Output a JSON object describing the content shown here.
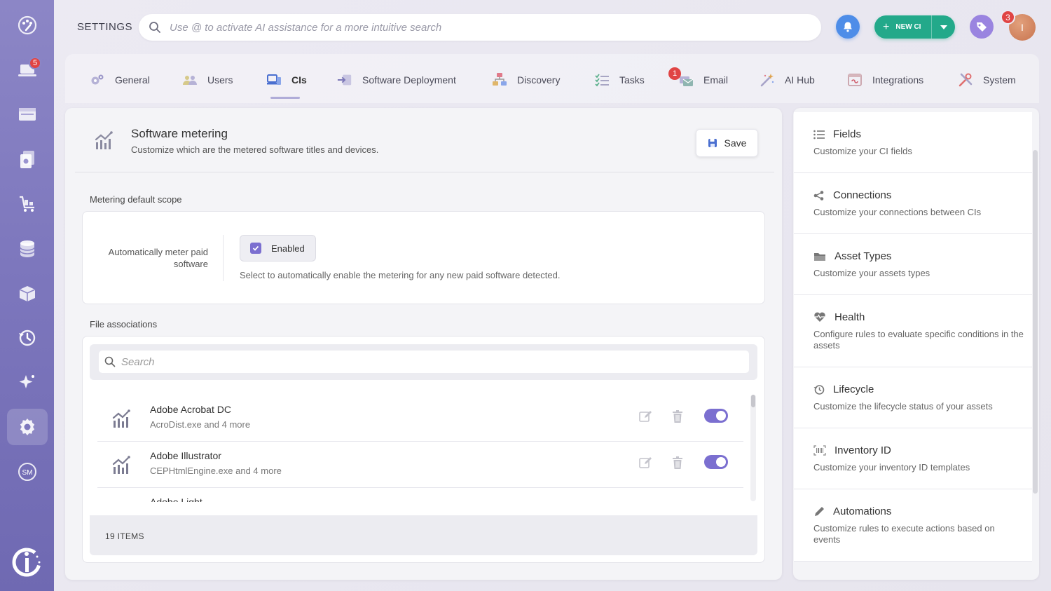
{
  "rail": {
    "items": [
      {
        "icon": "palette-icon"
      },
      {
        "icon": "laptop-icon",
        "badge": "5"
      },
      {
        "icon": "window-icon"
      },
      {
        "icon": "documents-icon"
      },
      {
        "icon": "cart-icon"
      },
      {
        "icon": "database-icon"
      },
      {
        "icon": "box-icon"
      },
      {
        "icon": "history-icon"
      },
      {
        "icon": "sparkle-icon"
      },
      {
        "icon": "gear-icon",
        "active": true
      },
      {
        "icon": "sm-icon",
        "label": "SM"
      }
    ]
  },
  "header": {
    "title": "SETTINGS",
    "search_placeholder": "Use @ to activate AI assistance for a more intuitive search",
    "new_ci_label": "NEW CI",
    "avatar_initial": "I",
    "notifications_badge": "3"
  },
  "tabs": [
    {
      "label": "General",
      "icon": "gears-icon"
    },
    {
      "label": "Users",
      "icon": "users-icon"
    },
    {
      "label": "CIs",
      "icon": "cis-icon",
      "active": true
    },
    {
      "label": "Software Deployment",
      "icon": "deploy-icon"
    },
    {
      "label": "Discovery",
      "icon": "discovery-icon"
    },
    {
      "label": "Tasks",
      "icon": "tasks-icon"
    },
    {
      "label": "Email",
      "icon": "email-icon",
      "badge": "1"
    },
    {
      "label": "AI Hub",
      "icon": "wand-icon"
    },
    {
      "label": "Integrations",
      "icon": "integrations-icon"
    },
    {
      "label": "System",
      "icon": "tools-icon"
    }
  ],
  "main": {
    "title": "Software metering",
    "subtitle": "Customize which are the metered software titles and devices.",
    "save_label": "Save",
    "scope_section_label": "Metering default scope",
    "scope_field_label": "Automatically meter paid software",
    "enabled_label": "Enabled",
    "enabled_checked": true,
    "scope_help": "Select to automatically enable the metering for any new paid software detected.",
    "files_section_label": "File associations",
    "files_search_placeholder": "Search",
    "rows": [
      {
        "title": "Adobe Acrobat DC",
        "subtitle": "AcroDist.exe and 4 more",
        "enabled": true
      },
      {
        "title": "Adobe Illustrator",
        "subtitle": "CEPHtmlEngine.exe and 4 more",
        "enabled": true
      }
    ],
    "partial_row_title": "Adobe Light",
    "items_count": "19",
    "items_label": "ITEMS"
  },
  "right_panel": {
    "items": [
      {
        "title": "Fields",
        "desc": "Customize your CI fields",
        "icon": "list-icon"
      },
      {
        "title": "Connections",
        "desc": "Customize your connections between CIs",
        "icon": "share-icon"
      },
      {
        "title": "Asset Types",
        "desc": "Customize your assets types",
        "icon": "folder-icon"
      },
      {
        "title": "Health",
        "desc": "Configure rules to evaluate specific conditions in the assets",
        "icon": "heartbeat-icon"
      },
      {
        "title": "Lifecycle",
        "desc": "Customize the lifecycle status of your assets",
        "icon": "history-icon"
      },
      {
        "title": "Inventory ID",
        "desc": "Customize your inventory ID templates",
        "icon": "barcode-icon"
      },
      {
        "title": "Automations",
        "desc": "Customize rules to execute actions based on events",
        "icon": "pencil-icon"
      }
    ]
  },
  "colors": {
    "rail": "#7d77bd",
    "accent": "#7b6fd0",
    "new_ci": "#23a98a",
    "bell": "#4e8de8",
    "badge": "#e04444"
  }
}
